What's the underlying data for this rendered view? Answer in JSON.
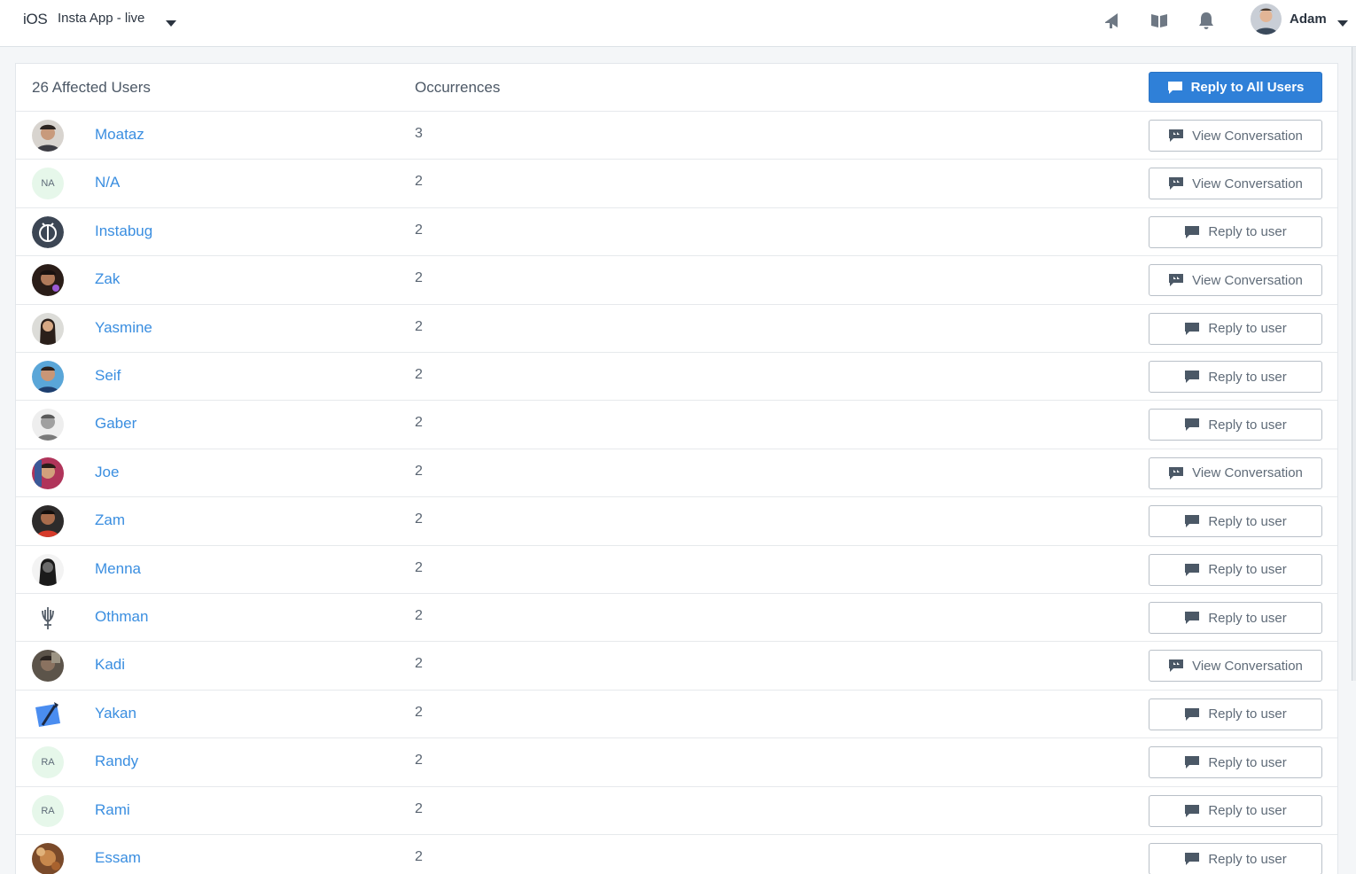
{
  "header": {
    "platform": "iOS",
    "app_name": "Insta App - live",
    "user_name": "Adam",
    "icons": [
      "announcement-icon",
      "docs-book-icon",
      "notifications-bell-icon"
    ]
  },
  "table": {
    "users_header": "26 Affected Users",
    "occurrences_header": "Occurrences",
    "reply_all_label": "Reply to All Users",
    "rows": [
      {
        "name": "Moataz",
        "occurrences": "3",
        "action": "View Conversation",
        "avatar": "photo"
      },
      {
        "name": "N/A",
        "occurrences": "2",
        "action": "View Conversation",
        "avatar": "initials",
        "initials": "NA"
      },
      {
        "name": "Instabug",
        "occurrences": "2",
        "action": "Reply to user",
        "avatar": "logo"
      },
      {
        "name": "Zak",
        "occurrences": "2",
        "action": "View Conversation",
        "avatar": "photo"
      },
      {
        "name": "Yasmine",
        "occurrences": "2",
        "action": "Reply to user",
        "avatar": "photo"
      },
      {
        "name": "Seif",
        "occurrences": "2",
        "action": "Reply to user",
        "avatar": "photo"
      },
      {
        "name": "Gaber",
        "occurrences": "2",
        "action": "Reply to user",
        "avatar": "photo"
      },
      {
        "name": "Joe",
        "occurrences": "2",
        "action": "View Conversation",
        "avatar": "photo"
      },
      {
        "name": "Zam",
        "occurrences": "2",
        "action": "Reply to user",
        "avatar": "photo"
      },
      {
        "name": "Menna",
        "occurrences": "2",
        "action": "Reply to user",
        "avatar": "photo"
      },
      {
        "name": "Othman",
        "occurrences": "2",
        "action": "Reply to user",
        "avatar": "logo"
      },
      {
        "name": "Kadi",
        "occurrences": "2",
        "action": "View Conversation",
        "avatar": "photo"
      },
      {
        "name": "Yakan",
        "occurrences": "2",
        "action": "Reply to user",
        "avatar": "logo"
      },
      {
        "name": "Randy",
        "occurrences": "2",
        "action": "Reply to user",
        "avatar": "initials",
        "initials": "RA"
      },
      {
        "name": "Rami",
        "occurrences": "2",
        "action": "Reply to user",
        "avatar": "initials",
        "initials": "RA"
      },
      {
        "name": "Essam",
        "occurrences": "2",
        "action": "Reply to user",
        "avatar": "photo"
      }
    ]
  },
  "colors": {
    "accent": "#2f80d8",
    "link": "#3a8ee0",
    "initials_bg": "#e6f7ea"
  }
}
